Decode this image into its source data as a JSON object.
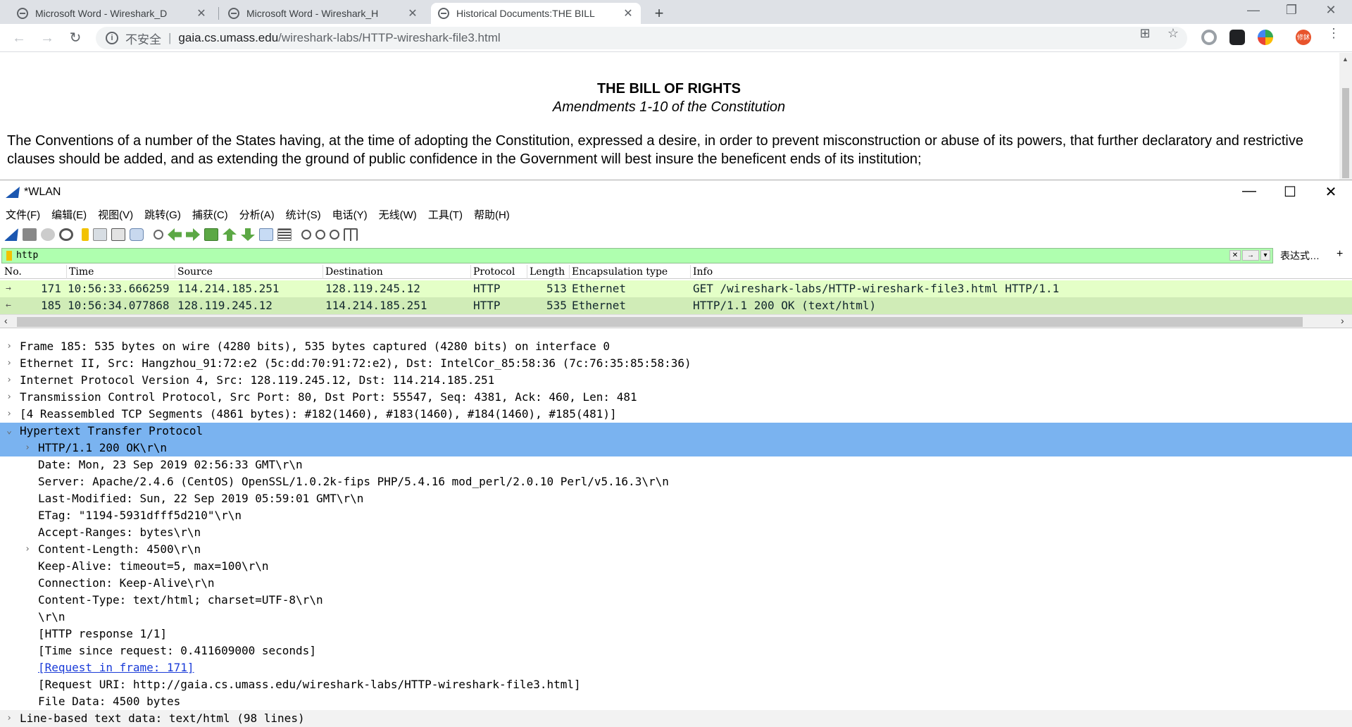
{
  "browser": {
    "tabs": [
      {
        "label": "Microsoft Word - Wireshark_D"
      },
      {
        "label": "Microsoft Word - Wireshark_H"
      },
      {
        "label": "Historical Documents:THE BILL"
      }
    ],
    "new_tab": "+",
    "window_controls": {
      "minimize": "—",
      "restore": "❐",
      "close": "✕"
    },
    "nav": {
      "back": "←",
      "forward": "→",
      "reload": "↻"
    },
    "address": {
      "info_icon": "i",
      "security": "不安全",
      "separator": "|",
      "host": "gaia.cs.umass.edu",
      "path": "/wireshark-labs/HTTP-wireshark-file3.html"
    },
    "icons": {
      "translate": "⊞",
      "star": "☆",
      "menu": "⋮"
    },
    "profile_label": "修鉥"
  },
  "webpage": {
    "title": "THE BILL OF RIGHTS",
    "subtitle": "Amendments 1-10 of the Constitution",
    "paragraph": "The Conventions of a number of the States having, at the time of adopting the Constitution, expressed a desire, in order to prevent misconstruction or abuse of its powers, that further declaratory and restrictive clauses should be added, and as extending the ground of public confidence in the Government will best insure the beneficent ends of its institution;"
  },
  "wireshark": {
    "title": "*WLAN",
    "window_controls": {
      "minimize": "—",
      "maximize": "☐",
      "close": "✕"
    },
    "menu": [
      "文件(F)",
      "编辑(E)",
      "视图(V)",
      "跳转(G)",
      "捕获(C)",
      "分析(A)",
      "统计(S)",
      "电话(Y)",
      "无线(W)",
      "工具(T)",
      "帮助(H)"
    ],
    "filter": {
      "value": "http",
      "clear": "✕",
      "apply": "→",
      "dropdown": "▾",
      "expression_label": "表达式…",
      "add": "+"
    },
    "columns": [
      "No.",
      "Time",
      "Source",
      "Destination",
      "Protocol",
      "Length",
      "Encapsulation type",
      "Info"
    ],
    "packets": [
      {
        "marker": "→",
        "no": "171",
        "time": "10:56:33.666259",
        "source": "114.214.185.251",
        "destination": "128.119.245.12",
        "protocol": "HTTP",
        "length": "513",
        "encap": "Ethernet",
        "info": "GET /wireshark-labs/HTTP-wireshark-file3.html HTTP/1.1"
      },
      {
        "marker": "←",
        "no": "185",
        "time": "10:56:34.077868",
        "source": "128.119.245.12",
        "destination": "114.214.185.251",
        "protocol": "HTTP",
        "length": "535",
        "encap": "Ethernet",
        "info": "HTTP/1.1 200 OK  (text/html)"
      }
    ],
    "scroll": {
      "left": "‹",
      "right": "›"
    },
    "details": [
      {
        "arrow": "›",
        "text": "Frame 185: 535 bytes on wire (4280 bits), 535 bytes captured (4280 bits) on interface 0"
      },
      {
        "arrow": "›",
        "text": "Ethernet II, Src: Hangzhou_91:72:e2 (5c:dd:70:91:72:e2), Dst: IntelCor_85:58:36 (7c:76:35:85:58:36)"
      },
      {
        "arrow": "›",
        "text": "Internet Protocol Version 4, Src: 128.119.245.12, Dst: 114.214.185.251"
      },
      {
        "arrow": "›",
        "text": "Transmission Control Protocol, Src Port: 80, Dst Port: 55547, Seq: 4381, Ack: 460, Len: 481"
      },
      {
        "arrow": "›",
        "text": "[4 Reassembled TCP Segments (4861 bytes): #182(1460), #183(1460), #184(1460), #185(481)]"
      },
      {
        "arrow": "⌄",
        "text": "Hypertext Transfer Protocol"
      },
      {
        "arrow": "›",
        "text": "HTTP/1.1 200 OK\\r\\n"
      },
      {
        "arrow": "",
        "text": "Date: Mon, 23 Sep 2019 02:56:33 GMT\\r\\n"
      },
      {
        "arrow": "",
        "text": "Server: Apache/2.4.6 (CentOS) OpenSSL/1.0.2k-fips PHP/5.4.16 mod_perl/2.0.10 Perl/v5.16.3\\r\\n"
      },
      {
        "arrow": "",
        "text": "Last-Modified: Sun, 22 Sep 2019 05:59:01 GMT\\r\\n"
      },
      {
        "arrow": "",
        "text": "ETag: \"1194-5931dfff5d210\"\\r\\n"
      },
      {
        "arrow": "",
        "text": "Accept-Ranges: bytes\\r\\n"
      },
      {
        "arrow": "›",
        "text": "Content-Length: 4500\\r\\n"
      },
      {
        "arrow": "",
        "text": "Keep-Alive: timeout=5, max=100\\r\\n"
      },
      {
        "arrow": "",
        "text": "Connection: Keep-Alive\\r\\n"
      },
      {
        "arrow": "",
        "text": "Content-Type: text/html; charset=UTF-8\\r\\n"
      },
      {
        "arrow": "",
        "text": "\\r\\n"
      },
      {
        "arrow": "",
        "text": "[HTTP response 1/1]"
      },
      {
        "arrow": "",
        "text": "[Time since request: 0.411609000 seconds]"
      },
      {
        "arrow": "",
        "text": "[Request in frame: 171]"
      },
      {
        "arrow": "",
        "text": "[Request URI: http://gaia.cs.umass.edu/wireshark-labs/HTTP-wireshark-file3.html]"
      },
      {
        "arrow": "",
        "text": "File Data: 4500 bytes"
      },
      {
        "arrow": "›",
        "text": "Line-based text data: text/html (98 lines)"
      }
    ],
    "colors": {
      "selected_row": "#7ab3f0",
      "packet_171": "#e4ffc7",
      "packet_185": "#d0ecb7",
      "filter_ok": "#afffaf"
    }
  }
}
